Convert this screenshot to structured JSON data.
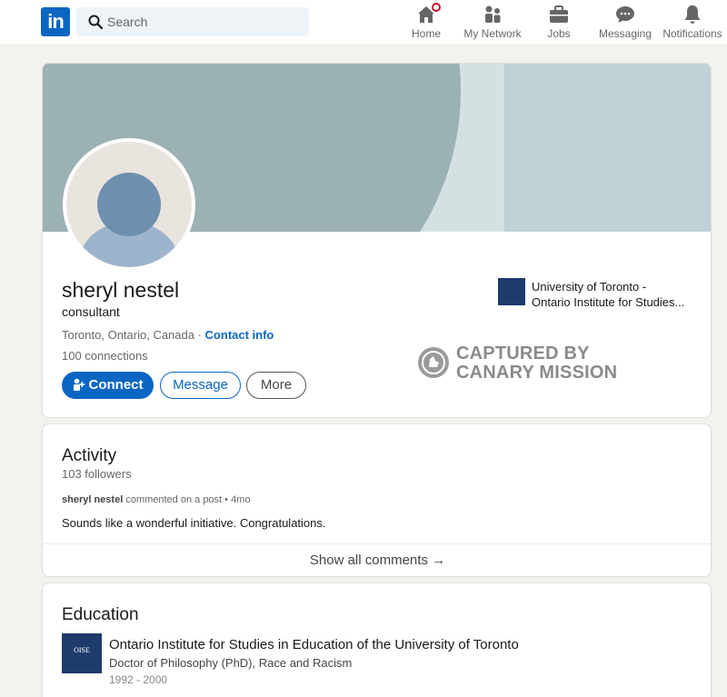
{
  "nav": {
    "logo_text": "in",
    "search_placeholder": "Search",
    "items": [
      {
        "label": "Home",
        "icon": "home-icon"
      },
      {
        "label": "My Network",
        "icon": "network-icon"
      },
      {
        "label": "Jobs",
        "icon": "briefcase-icon"
      },
      {
        "label": "Messaging",
        "icon": "chat-icon"
      },
      {
        "label": "Notifications",
        "icon": "bell-icon"
      }
    ]
  },
  "profile": {
    "name": "sheryl nestel",
    "headline": "consultant",
    "location": "Toronto, Ontario, Canada",
    "location_sep": " · ",
    "contact_info": "Contact info",
    "connections": "100 connections",
    "buttons": {
      "connect": "Connect",
      "message": "Message",
      "more": "More"
    },
    "top_education": {
      "line1": "University of Toronto -",
      "line2": "Ontario Institute for Studies..."
    },
    "watermark": {
      "line1": "CAPTURED BY",
      "line2": "CANARY MISSION"
    }
  },
  "activity": {
    "title": "Activity",
    "followers": "103 followers",
    "post_author": "sheryl nestel",
    "post_action": " commented on a post • 4mo",
    "post_text": "Sounds like a wonderful initiative. Congratulations.",
    "show_all": "Show all comments →"
  },
  "education": {
    "title": "Education",
    "logo_text": "OISE",
    "school": "Ontario Institute for Studies in Education of the University of Toronto",
    "degree": "Doctor of Philosophy (PhD), Race and Racism",
    "dates": "1992 - 2000"
  },
  "colors": {
    "brand": "#0a66c2",
    "badge": "#cb112d",
    "page_bg": "#f4f2ee"
  }
}
